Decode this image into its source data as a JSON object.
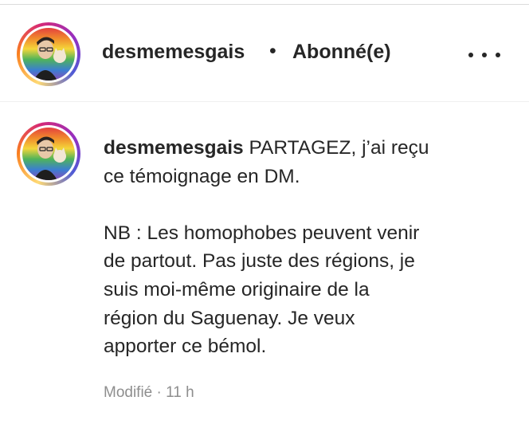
{
  "header": {
    "username": "desmemesgais",
    "separator": "•",
    "follow_status": "Abonné(e)",
    "more_icon": "more-horizontal-icon"
  },
  "caption": {
    "username": "desmemesgais",
    "line1_rest": " PARTAGEZ, j’ai reçu",
    "line2": "ce témoignage en DM.",
    "para2_lines": [
      "NB : Les homophobes peuvent venir",
      "de partout. Pas juste des régions, je",
      "suis moi-même originaire de la",
      "région du Saguenay. Je veux",
      "apporter ce bémol."
    ]
  },
  "meta": {
    "edited": "Modifié",
    "separator": " · ",
    "time": "11 h"
  },
  "colors": {
    "text": "#262626",
    "secondary": "#8e8e8e",
    "story_ring": [
      "#feda75",
      "#fa7e1e",
      "#d62976",
      "#962fbf",
      "#4f5bd5"
    ]
  }
}
